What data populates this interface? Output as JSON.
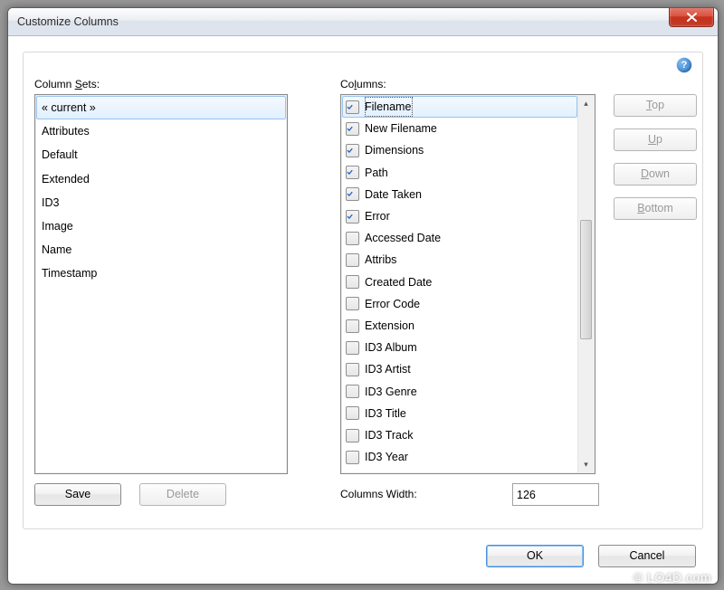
{
  "window": {
    "title": "Customize Columns"
  },
  "labels": {
    "column_sets": "Column Sets:",
    "column_sets_access": "S",
    "columns": "Columns:",
    "columns_access": "l",
    "columns_width": "Columns Width:"
  },
  "column_sets": [
    {
      "label": "« current »",
      "selected": true
    },
    {
      "label": "Attributes"
    },
    {
      "label": "Default"
    },
    {
      "label": "Extended"
    },
    {
      "label": "ID3"
    },
    {
      "label": "Image"
    },
    {
      "label": "Name"
    },
    {
      "label": "Timestamp"
    }
  ],
  "columns_list": [
    {
      "label": "Filename",
      "checked": true,
      "selected": true
    },
    {
      "label": "New Filename",
      "checked": true
    },
    {
      "label": "Dimensions",
      "checked": true
    },
    {
      "label": "Path",
      "checked": true
    },
    {
      "label": "Date Taken",
      "checked": true
    },
    {
      "label": "Error",
      "checked": true
    },
    {
      "label": "Accessed Date",
      "checked": false
    },
    {
      "label": "Attribs",
      "checked": false
    },
    {
      "label": "Created Date",
      "checked": false
    },
    {
      "label": "Error Code",
      "checked": false
    },
    {
      "label": "Extension",
      "checked": false
    },
    {
      "label": "ID3 Album",
      "checked": false
    },
    {
      "label": "ID3 Artist",
      "checked": false
    },
    {
      "label": "ID3 Genre",
      "checked": false
    },
    {
      "label": "ID3 Title",
      "checked": false
    },
    {
      "label": "ID3 Track",
      "checked": false
    },
    {
      "label": "ID3 Year",
      "checked": false
    }
  ],
  "columns_width_value": "126",
  "buttons": {
    "save": "Save",
    "delete": "Delete",
    "top": "Top",
    "up": "Up",
    "down": "Down",
    "bottom": "Bottom",
    "ok": "OK",
    "cancel": "Cancel"
  },
  "help_glyph": "?",
  "watermark": "© LO4D.com"
}
